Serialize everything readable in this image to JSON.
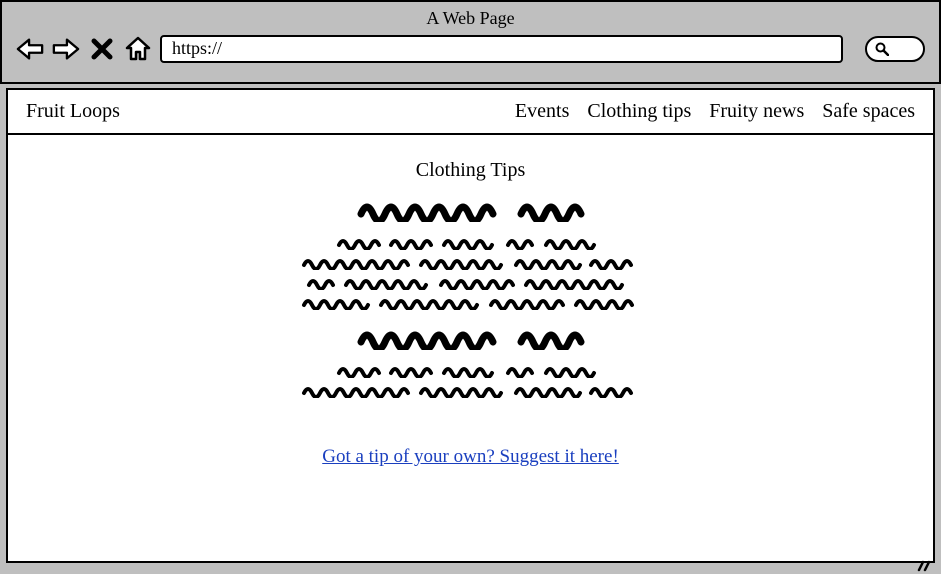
{
  "browser": {
    "title": "A Web Page",
    "url": "https://"
  },
  "site": {
    "brand": "Fruit Loops",
    "nav": {
      "events": "Events",
      "clothing": "Clothing tips",
      "news": "Fruity news",
      "safe": "Safe spaces"
    }
  },
  "page": {
    "title": "Clothing Tips",
    "suggest_link": "Got a tip of your own? Suggest it here!"
  }
}
